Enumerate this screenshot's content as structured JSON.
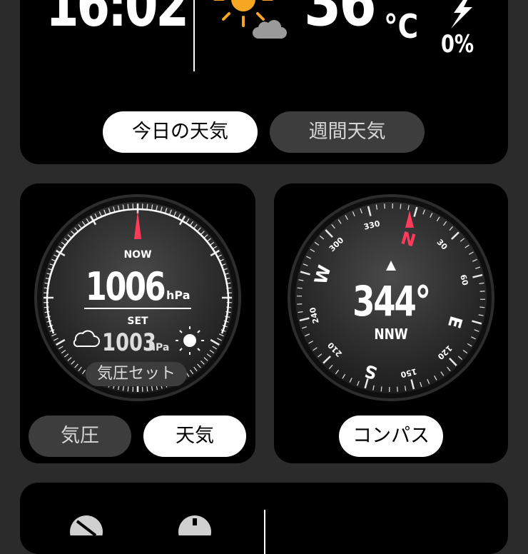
{
  "top": {
    "time": "16:02",
    "temperature": "36",
    "temp_unit": "°C",
    "precip": "0%",
    "tabs": [
      {
        "label": "今日の天気",
        "active": true
      },
      {
        "label": "週間天気",
        "active": false
      }
    ]
  },
  "barometer": {
    "now_label": "NOW",
    "now_value": "1006",
    "now_unit": "hPa",
    "set_label": "SET",
    "set_value": "1003",
    "set_unit": "hPa",
    "set_button": "気圧セット",
    "tabs": [
      {
        "label": "気圧",
        "active": false
      },
      {
        "label": "天気",
        "active": true
      }
    ]
  },
  "compass": {
    "heading": "344°",
    "direction": "NNW",
    "labels": {
      "n": "N",
      "e": "E",
      "s": "S",
      "w": "W",
      "d30": "30",
      "d60": "60",
      "d120": "120",
      "d150": "150",
      "d210": "210",
      "d240": "240",
      "d300": "300",
      "d330": "330"
    },
    "tab": "コンパス"
  },
  "colors": {
    "accent": "#ff3b5c",
    "sun": "#f6a623",
    "cloud": "#9a9a9a"
  }
}
